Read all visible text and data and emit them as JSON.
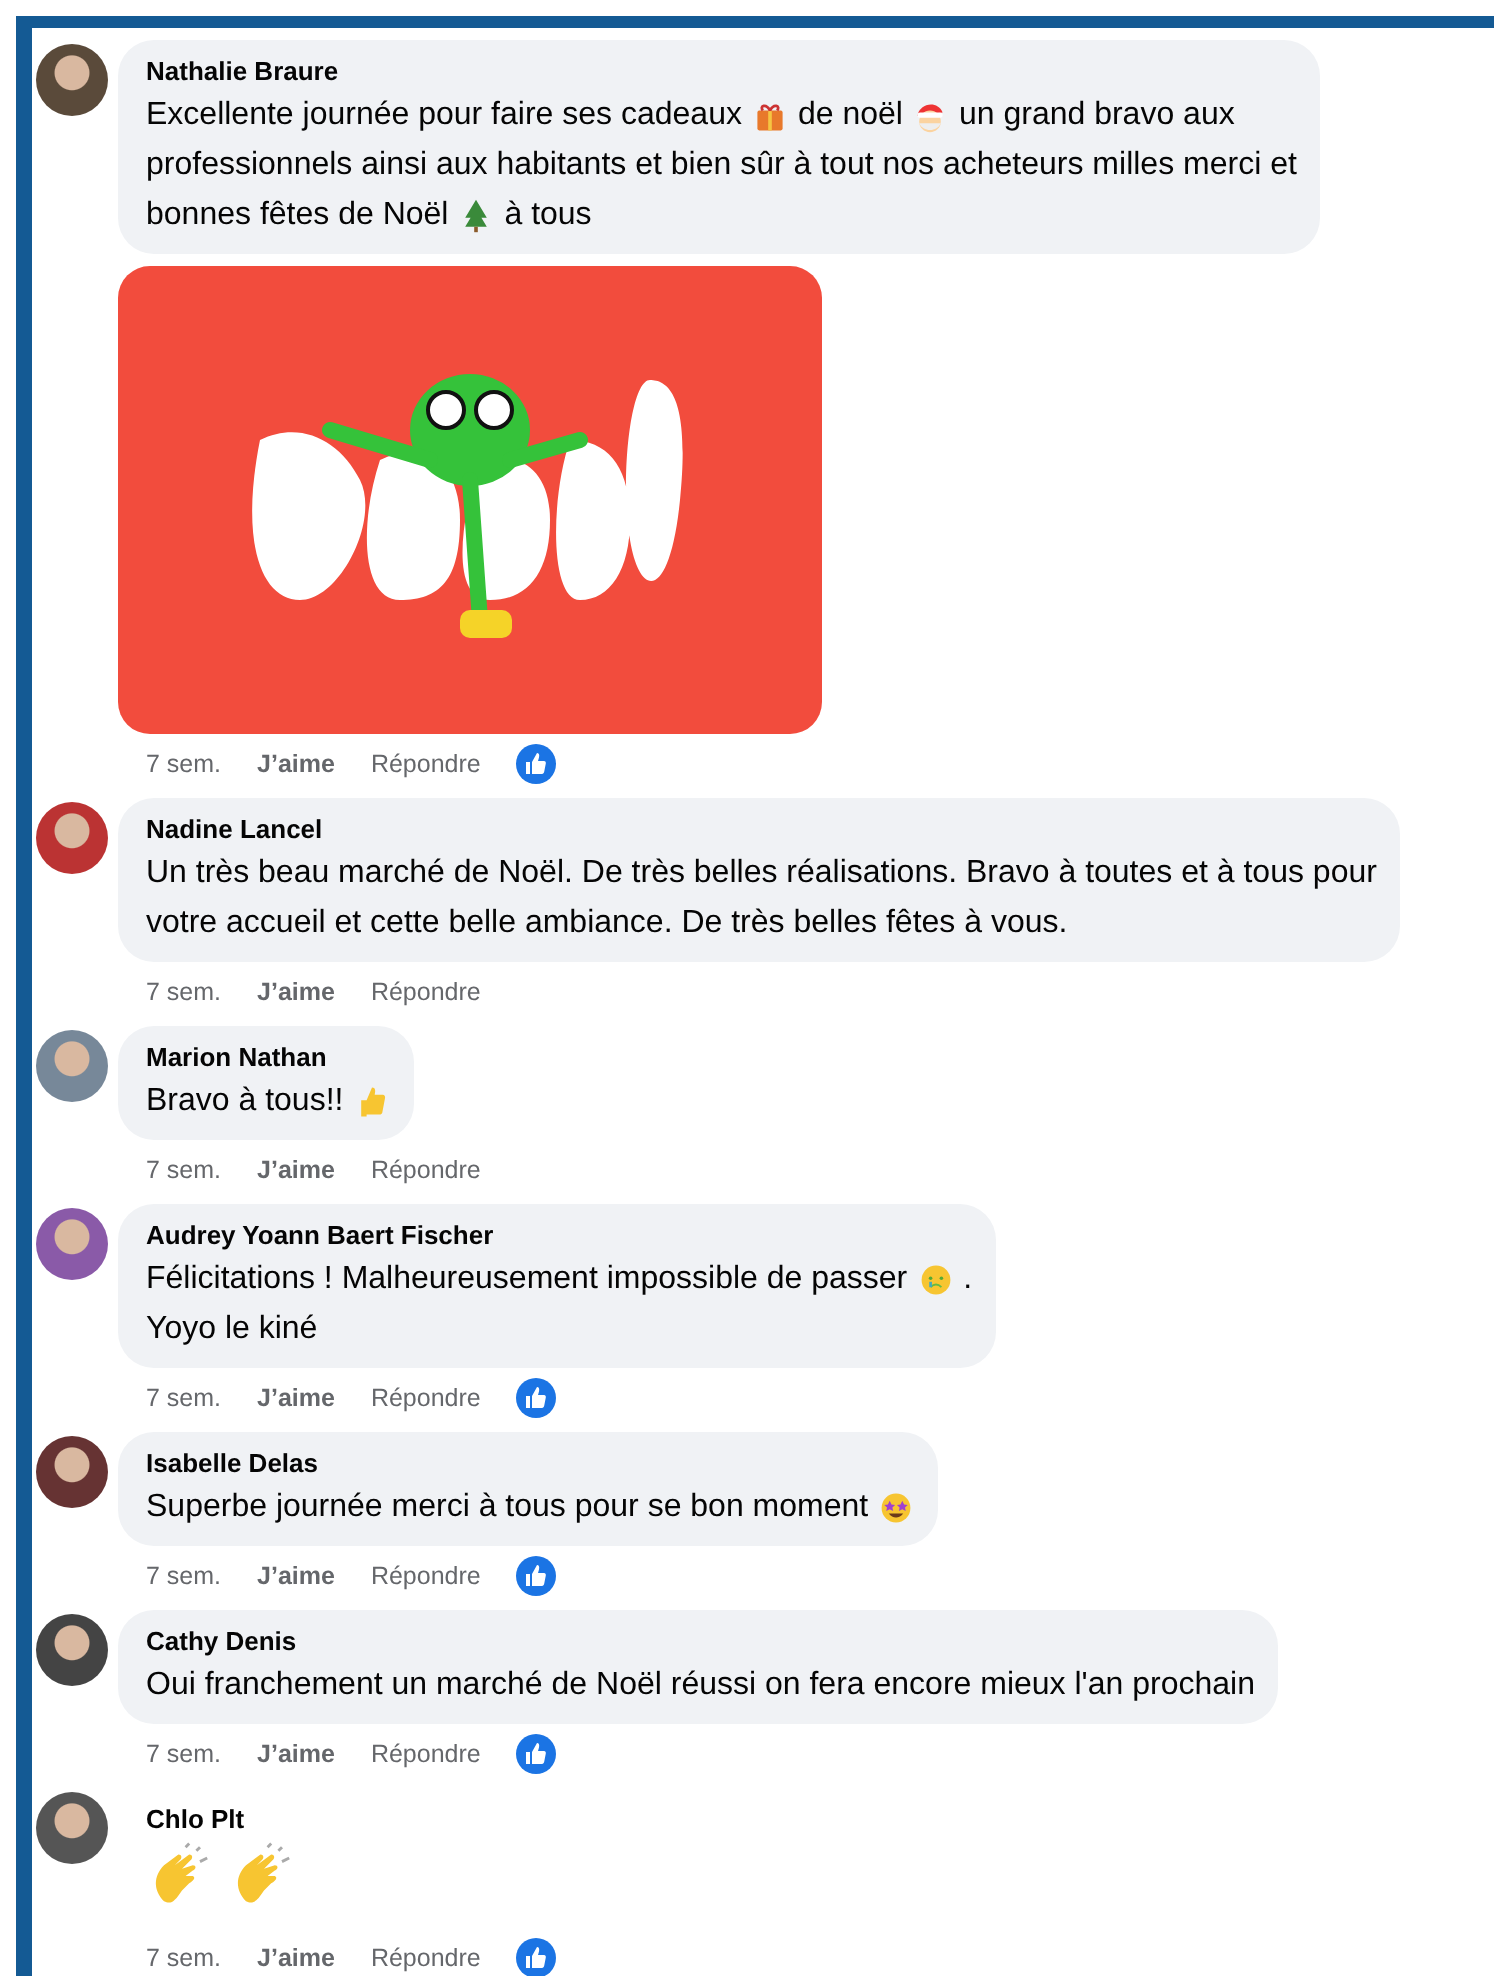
{
  "comments": [
    {
      "author": "Nathalie Braure",
      "lines": [
        [
          {
            "kind": "text",
            "text": "Excellente journée pour faire ses cadeaux"
          },
          {
            "kind": "gift"
          },
          {
            "kind": "text",
            "text": "de noël"
          },
          {
            "kind": "santa"
          },
          {
            "kind": "text",
            "text": "un grand bravo aux"
          }
        ],
        [
          {
            "kind": "text",
            "text": "professionnels ainsi aux habitants et bien sûr à tout nos acheteurs milles merci et"
          }
        ],
        [
          {
            "kind": "text",
            "text": "bonnes fêtes de Noël"
          },
          {
            "kind": "tree"
          },
          {
            "kind": "text",
            "text": "à tous"
          }
        ]
      ],
      "gif": true,
      "time": "7 sem.",
      "like": "J’aime",
      "reply": "Répondre",
      "reacted": true,
      "bare": false
    },
    {
      "author": "Nadine Lancel",
      "lines": [
        [
          {
            "kind": "text",
            "text": "Un très beau marché de Noël. De très belles réalisations. Bravo à toutes et à tous pour"
          }
        ],
        [
          {
            "kind": "text",
            "text": "votre accueil et cette belle ambiance. De très belles fêtes à vous."
          }
        ]
      ],
      "gif": false,
      "time": "7 sem.",
      "like": "J’aime",
      "reply": "Répondre",
      "reacted": false,
      "bare": false
    },
    {
      "author": "Marion Nathan",
      "lines": [
        [
          {
            "kind": "text",
            "text": "Bravo à tous!!"
          },
          {
            "kind": "thumb"
          }
        ]
      ],
      "gif": false,
      "time": "7 sem.",
      "like": "J’aime",
      "reply": "Répondre",
      "reacted": false,
      "bare": false
    },
    {
      "author": "Audrey Yoann Baert Fischer",
      "lines": [
        [
          {
            "kind": "text",
            "text": "Félicitations ! Malheureusement impossible de passer"
          },
          {
            "kind": "sad"
          },
          {
            "kind": "text",
            "text": "."
          }
        ],
        [
          {
            "kind": "text",
            "text": "Yoyo le kiné"
          }
        ]
      ],
      "gif": false,
      "time": "7 sem.",
      "like": "J’aime",
      "reply": "Répondre",
      "reacted": true,
      "bare": false
    },
    {
      "author": "Isabelle Delas",
      "lines": [
        [
          {
            "kind": "text",
            "text": "Superbe journée merci à tous pour se bon moment"
          },
          {
            "kind": "stars"
          }
        ]
      ],
      "gif": false,
      "time": "7 sem.",
      "like": "J’aime",
      "reply": "Répondre",
      "reacted": true,
      "bare": false
    },
    {
      "author": "Cathy Denis",
      "lines": [
        [
          {
            "kind": "text",
            "text": "Oui franchement un marché de Noël réussi on fera encore mieux l'an prochain"
          }
        ]
      ],
      "gif": false,
      "time": "7 sem.",
      "like": "J’aime",
      "reply": "Répondre",
      "reacted": true,
      "bare": false
    },
    {
      "author": "Chlo Plt",
      "lines": [
        [
          {
            "kind": "clap"
          },
          {
            "kind": "clap"
          }
        ]
      ],
      "gif": false,
      "time": "7 sem.",
      "like": "J’aime",
      "reply": "Répondre",
      "reacted": true,
      "bare": true
    }
  ]
}
